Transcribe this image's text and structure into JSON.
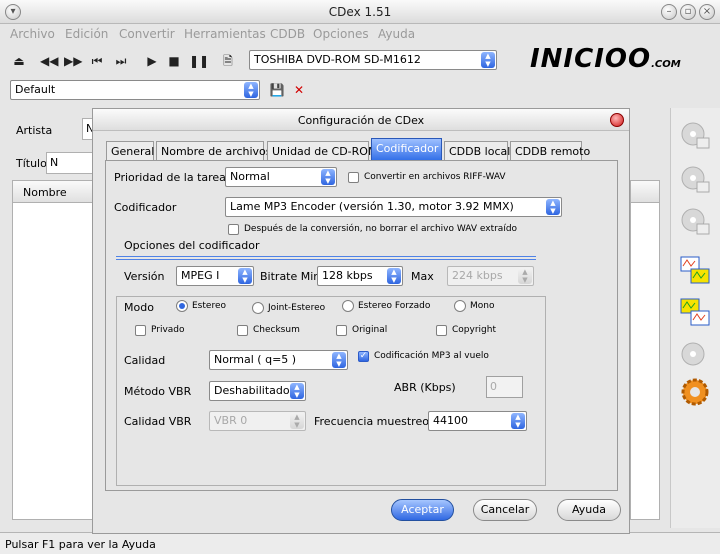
{
  "window": {
    "title": "CDex 1.51"
  },
  "menu": [
    "Archivo",
    "Edición",
    "Convertir",
    "Herramientas",
    "CDDB",
    "Opciones",
    "Ayuda"
  ],
  "toolbar": {
    "drive": "TOSHIBA DVD-ROM SD-M1612",
    "profile": "Default"
  },
  "logo": {
    "text": "INICIOO",
    "suffix": ".COM"
  },
  "main": {
    "artist_label": "Artista",
    "title_label": "Título",
    "col_name": "Nombre",
    "artist_value": "N",
    "title_value": "N"
  },
  "status": "Pulsar F1 para ver la Ayuda",
  "dialog": {
    "title": "Configuración de CDex",
    "tabs": [
      "General",
      "Nombre de archivos",
      "Unidad de CD-ROM",
      "Codificador",
      "CDDB local",
      "CDDB remoto"
    ],
    "priority_label": "Prioridad de la tarea",
    "priority_value": "Normal",
    "riff_label": "Convertir en archivos RIFF-WAV",
    "encoder_label": "Codificador",
    "encoder_value": "Lame MP3 Encoder (versión 1.30, motor 3.92 MMX)",
    "keep_wav_label": "Después de la conversión, no borrar el archivo WAV extraído",
    "group_title": "Opciones del codificador",
    "version_label": "Versión",
    "version_value": "MPEG I",
    "bitrate_min_label": "Bitrate Min",
    "bitrate_min_value": "128 kbps",
    "max_label": "Max",
    "max_value": "224 kbps",
    "mode_label": "Modo",
    "modes": [
      "Estereo",
      "Joint-Estereo",
      "Estereo Forzado",
      "Mono"
    ],
    "flags": [
      "Privado",
      "Checksum",
      "Original",
      "Copyright"
    ],
    "quality_label": "Calidad",
    "quality_value": "Normal ( q=5 )",
    "onthefly_label": "Codificación MP3 al vuelo",
    "vbr_method_label": "Método VBR",
    "vbr_method_value": "Deshabilitado",
    "abr_label": "ABR (Kbps)",
    "abr_value": "0",
    "vbr_quality_label": "Calidad VBR",
    "vbr_quality_value": "VBR 0",
    "sample_rate_label": "Frecuencia muestreo",
    "sample_rate_value": "44100",
    "ok": "Aceptar",
    "cancel": "Cancelar",
    "help": "Ayuda"
  }
}
